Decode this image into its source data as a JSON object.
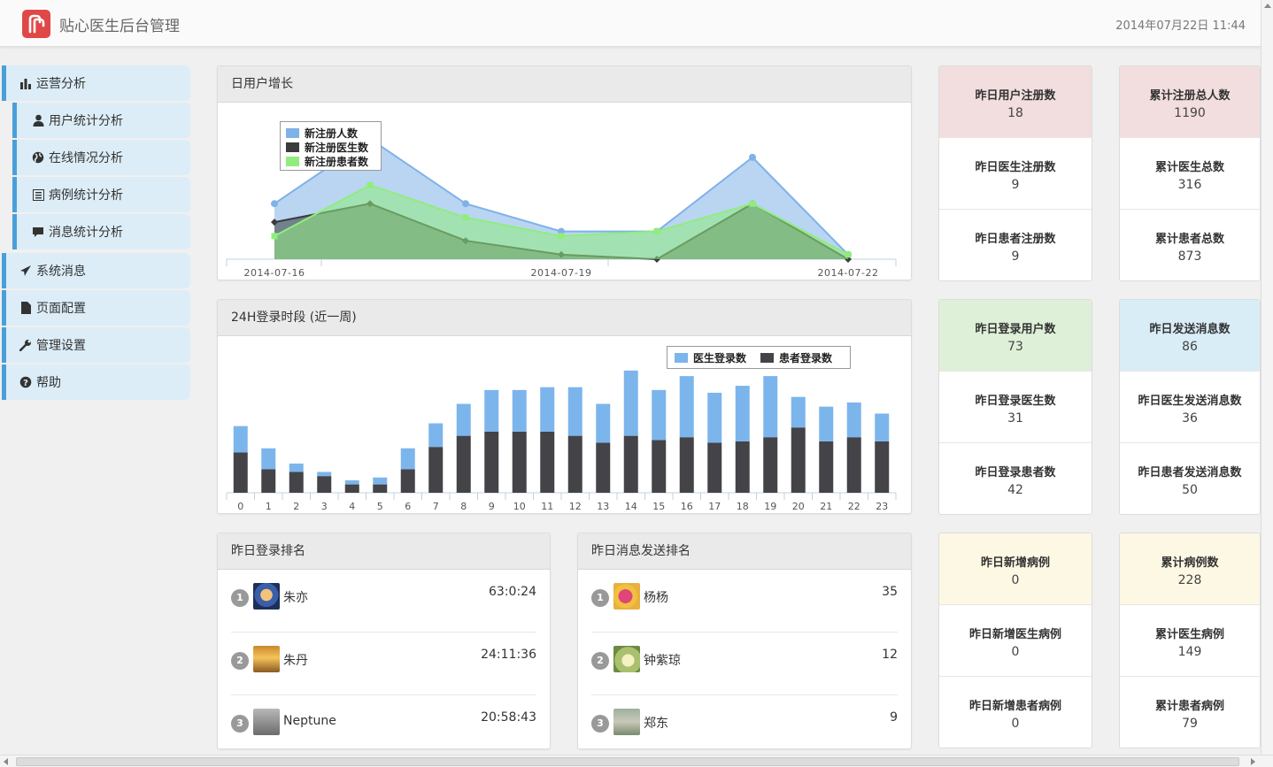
{
  "header": {
    "app_title": "贴心医生后台管理",
    "datetime": "2014年07月22日 11:44",
    "logo_color": "#e04848"
  },
  "sidebar": {
    "items": [
      {
        "label": "运营分析",
        "icon": "bar-chart-icon"
      },
      {
        "label": "用户统计分析",
        "icon": "user-icon"
      },
      {
        "label": "在线情况分析",
        "icon": "globe-icon"
      },
      {
        "label": "病例统计分析",
        "icon": "list-icon"
      },
      {
        "label": "消息统计分析",
        "icon": "comment-icon"
      },
      {
        "label": "系统消息",
        "icon": "send-icon"
      },
      {
        "label": "页面配置",
        "icon": "file-icon"
      },
      {
        "label": "管理设置",
        "icon": "wrench-icon"
      },
      {
        "label": "帮助",
        "icon": "help-icon"
      }
    ]
  },
  "daily_growth": {
    "title": "日用户增长",
    "legend": [
      "新注册人数",
      "新注册医生数",
      "新注册患者数"
    ]
  },
  "login_hours": {
    "title": "24H登录时段 (近一周)",
    "legend": [
      "医生登录数",
      "患者登录数"
    ]
  },
  "chart_data": [
    {
      "type": "area",
      "title": "日用户增长",
      "x": [
        "2014-07-16",
        "2014-07-17",
        "2014-07-18",
        "2014-07-19",
        "2014-07-20",
        "2014-07-21",
        "2014-07-22"
      ],
      "x_tick_labels": [
        "2014-07-16",
        "2014-07-19",
        "2014-07-22"
      ],
      "series": [
        {
          "name": "新注册人数",
          "values": [
            12,
            26,
            12,
            6,
            6,
            22,
            1
          ],
          "color": "#7fb2e8"
        },
        {
          "name": "新注册医生数",
          "values": [
            8,
            12,
            4,
            1,
            0,
            12,
            0
          ],
          "color": "#3b3b3d"
        },
        {
          "name": "新注册患者数",
          "values": [
            5,
            16,
            9,
            5,
            6,
            12,
            1
          ],
          "color": "#90ed7d"
        }
      ],
      "ylim": [
        0,
        30
      ],
      "legend_position": "top-left"
    },
    {
      "type": "bar",
      "title": "24H登录时段 (近一周)",
      "stacked": true,
      "categories": [
        "0",
        "1",
        "2",
        "3",
        "4",
        "5",
        "6",
        "7",
        "8",
        "9",
        "10",
        "11",
        "12",
        "13",
        "14",
        "15",
        "16",
        "17",
        "18",
        "19",
        "20",
        "21",
        "22",
        "23"
      ],
      "series": [
        {
          "name": "医生登录数",
          "values": [
            19,
            15,
            6,
            3,
            3,
            5,
            15,
            17,
            23,
            30,
            30,
            32,
            35,
            28,
            47,
            36,
            44,
            36,
            40,
            44,
            22,
            25,
            25,
            20
          ],
          "color": "#7cb5ec"
        },
        {
          "name": "患者登录数",
          "values": [
            29,
            17,
            15,
            12,
            6,
            6,
            17,
            33,
            41,
            44,
            44,
            44,
            41,
            36,
            41,
            38,
            40,
            36,
            37,
            40,
            47,
            37,
            40,
            37
          ],
          "color": "#434348"
        }
      ],
      "ylim": [
        0,
        100
      ],
      "legend_position": "top-right"
    }
  ],
  "stats": {
    "col1": [
      {
        "label": "昨日用户注册数",
        "value": "18"
      },
      {
        "label": "昨日医生注册数",
        "value": "9"
      },
      {
        "label": "昨日患者注册数",
        "value": "9"
      }
    ],
    "col2": [
      {
        "label": "累计注册总人数",
        "value": "1190"
      },
      {
        "label": "累计医生总数",
        "value": "316"
      },
      {
        "label": "累计患者总数",
        "value": "873"
      }
    ],
    "col3": [
      {
        "label": "昨日登录用户数",
        "value": "73"
      },
      {
        "label": "昨日登录医生数",
        "value": "31"
      },
      {
        "label": "昨日登录患者数",
        "value": "42"
      }
    ],
    "col4": [
      {
        "label": "昨日发送消息数",
        "value": "86"
      },
      {
        "label": "昨日医生发送消息数",
        "value": "36"
      },
      {
        "label": "昨日患者发送消息数",
        "value": "50"
      }
    ],
    "col5": [
      {
        "label": "昨日新增病例",
        "value": "0"
      },
      {
        "label": "昨日新增医生病例",
        "value": "0"
      },
      {
        "label": "昨日新增患者病例",
        "value": "0"
      }
    ],
    "col6": [
      {
        "label": "累计病例数",
        "value": "228"
      },
      {
        "label": "累计医生病例",
        "value": "149"
      },
      {
        "label": "累计患者病例",
        "value": "79"
      }
    ]
  },
  "login_rank": {
    "title": "昨日登录排名",
    "rows": [
      {
        "rank": "1",
        "name": "朱亦",
        "value": "63:0:24"
      },
      {
        "rank": "2",
        "name": "朱丹",
        "value": "24:11:36"
      },
      {
        "rank": "3",
        "name": "Neptune",
        "value": "20:58:43"
      }
    ]
  },
  "message_rank": {
    "title": "昨日消息发送排名",
    "rows": [
      {
        "rank": "1",
        "name": "杨杨",
        "value": "35"
      },
      {
        "rank": "2",
        "name": "钟紫琼",
        "value": "12"
      },
      {
        "rank": "3",
        "name": "郑东",
        "value": "9"
      }
    ]
  }
}
